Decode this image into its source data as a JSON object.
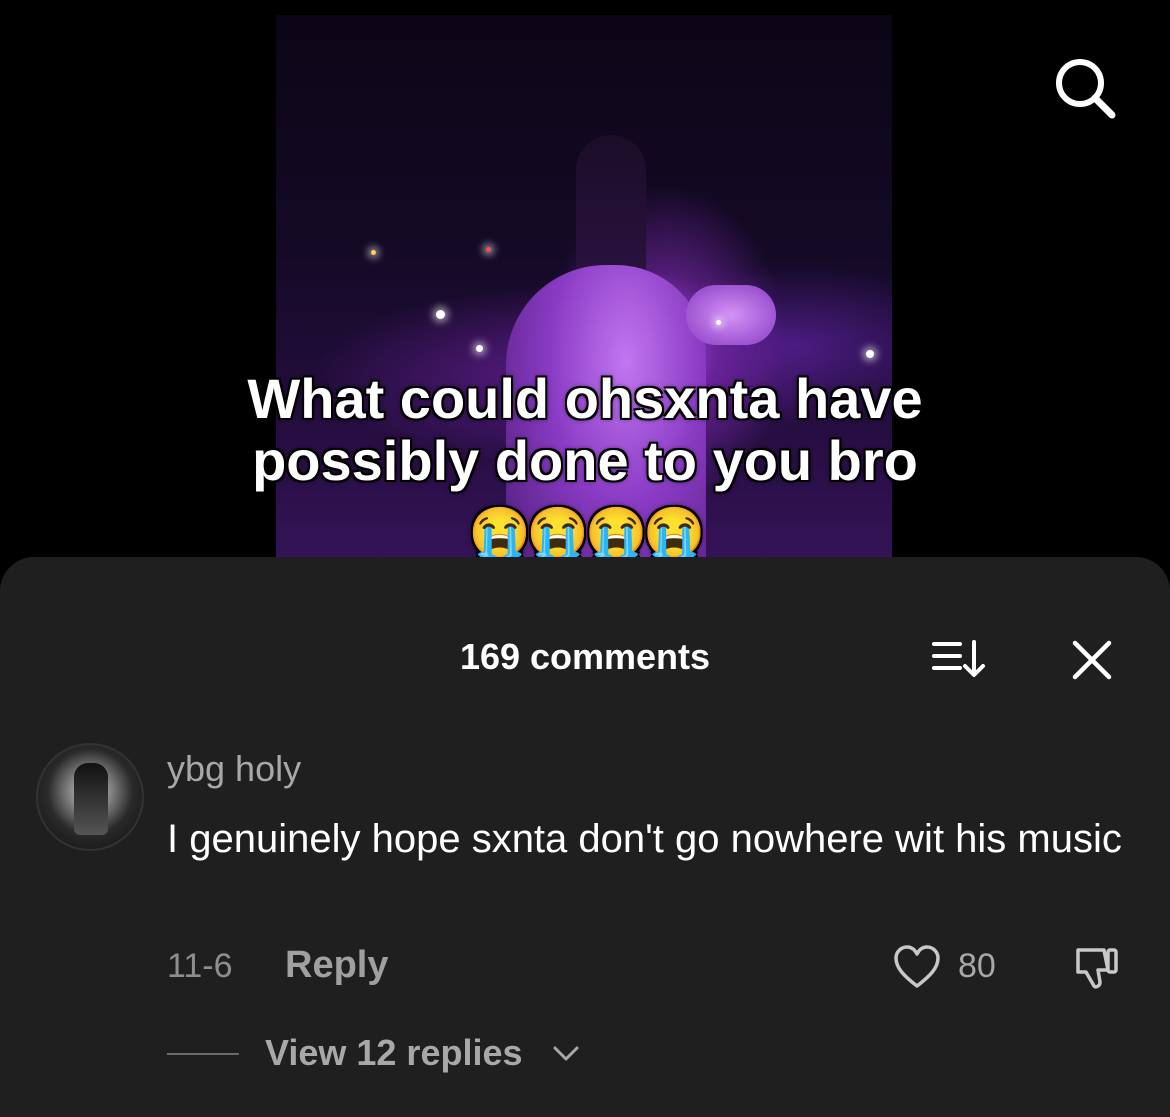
{
  "video": {
    "caption_line1": "What could ohsxnta have",
    "caption_line2": "possibly done to you bro",
    "caption_emoji": "😭😭😭😭"
  },
  "top_bar": {
    "search_icon": "search-icon"
  },
  "comments_sheet": {
    "title": "169 comments",
    "sort_icon": "sort-icon",
    "close_icon": "close-icon"
  },
  "comment": {
    "username": "ybg holy",
    "text": "I genuinely hope sxnta don't go nowhere wit his music",
    "date": "11-6",
    "reply_label": "Reply",
    "like_count": "80",
    "view_replies_label": "View 12 replies"
  },
  "colors": {
    "sheet_bg": "#1f1f1f",
    "muted_text": "#a8a8a8",
    "primary_text": "#ffffff"
  }
}
